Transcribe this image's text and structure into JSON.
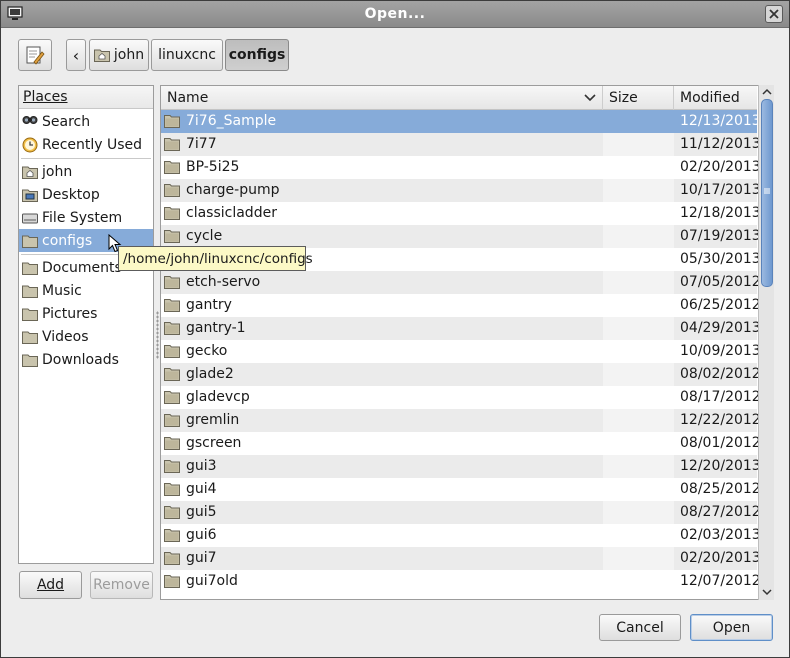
{
  "window": {
    "title": "Open..."
  },
  "path_bar": {
    "edit_icon": "pencil-icon",
    "back_label": "‹",
    "crumbs": [
      {
        "label": "john",
        "icon": "home-folder-icon"
      },
      {
        "label": "linuxcnc"
      },
      {
        "label": "configs"
      }
    ]
  },
  "places": {
    "header": "Places",
    "items": [
      {
        "label": "Search",
        "icon": "search-icon"
      },
      {
        "label": "Recently Used",
        "icon": "recent-icon"
      },
      {
        "label": "john",
        "icon": "home-icon"
      },
      {
        "label": "Desktop",
        "icon": "desktop-icon"
      },
      {
        "label": "File System",
        "icon": "drive-icon"
      },
      {
        "label": "configs",
        "icon": "folder-icon"
      },
      {
        "label": "Documents",
        "icon": "folder-icon"
      },
      {
        "label": "Music",
        "icon": "folder-icon"
      },
      {
        "label": "Pictures",
        "icon": "folder-icon"
      },
      {
        "label": "Videos",
        "icon": "folder-icon"
      },
      {
        "label": "Downloads",
        "icon": "folder-icon"
      }
    ],
    "add_label": "Add",
    "remove_label": "Remove"
  },
  "files": {
    "columns": {
      "name": "Name",
      "size": "Size",
      "modified": "Modified"
    },
    "rows": [
      {
        "name": "7i76_Sample",
        "modified": "12/13/2013"
      },
      {
        "name": "7i77",
        "modified": "11/12/2013"
      },
      {
        "name": "BP-5i25",
        "modified": "02/20/2013"
      },
      {
        "name": "charge-pump",
        "modified": "10/17/2013"
      },
      {
        "name": "classicladder",
        "modified": "12/18/2013"
      },
      {
        "name": "cycle",
        "modified": "07/19/2013"
      },
      {
        "name": "",
        "modified": "05/30/2013"
      },
      {
        "name": "etch-servo",
        "modified": "07/05/2012"
      },
      {
        "name": "gantry",
        "modified": "06/25/2012"
      },
      {
        "name": "gantry-1",
        "modified": "04/29/2013"
      },
      {
        "name": "gecko",
        "modified": "10/09/2013"
      },
      {
        "name": "glade2",
        "modified": "08/02/2012"
      },
      {
        "name": "gladevcp",
        "modified": "08/17/2012"
      },
      {
        "name": "gremlin",
        "modified": "12/22/2012"
      },
      {
        "name": "gscreen",
        "modified": "08/01/2012"
      },
      {
        "name": "gui3",
        "modified": "12/20/2013"
      },
      {
        "name": "gui4",
        "modified": "08/25/2012"
      },
      {
        "name": "gui5",
        "modified": "08/27/2012"
      },
      {
        "name": "gui6",
        "modified": "02/03/2013"
      },
      {
        "name": "gui7",
        "modified": "02/20/2013"
      },
      {
        "name": "gui7old",
        "modified": "12/07/2012"
      }
    ]
  },
  "tooltip": {
    "text": "/home/john/linuxcnc/configs"
  },
  "buttons": {
    "cancel_label": "Cancel",
    "open_label": "Open"
  },
  "colors": {
    "selection": "#86abd9",
    "tooltip_bg": "#fcf9c6"
  }
}
